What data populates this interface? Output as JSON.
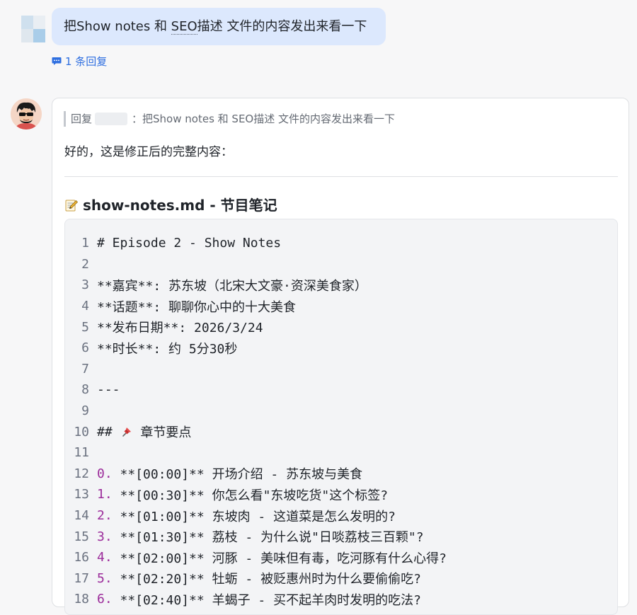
{
  "user_message": {
    "text_before": "把Show notes 和 ",
    "text_seo": "SEO",
    "text_after": "描述 文件的内容发出来看一下"
  },
  "thread": {
    "reply_count_label": "1 条回复"
  },
  "bot_message": {
    "quote_prefix": "回复",
    "quote_colon": "：",
    "quote_text": "把Show notes 和 SEO描述 文件的内容发出来看一下",
    "intro": "好的，这是修正后的完整内容：",
    "section_title": "show-notes.md - 节目笔记",
    "code_lines": [
      {
        "n": "1",
        "num": "",
        "text": "# Episode 2 - Show Notes"
      },
      {
        "n": "2",
        "num": "",
        "text": ""
      },
      {
        "n": "3",
        "num": "",
        "text": "**嘉宾**: 苏东坡（北宋大文豪·资深美食家）"
      },
      {
        "n": "4",
        "num": "",
        "text": "**话题**: 聊聊你心中的十大美食"
      },
      {
        "n": "5",
        "num": "",
        "text": "**发布日期**: 2026/3/24"
      },
      {
        "n": "6",
        "num": "",
        "text": "**时长**: 约 5分30秒"
      },
      {
        "n": "7",
        "num": "",
        "text": ""
      },
      {
        "n": "8",
        "num": "",
        "text": "---"
      },
      {
        "n": "9",
        "num": "",
        "text": ""
      },
      {
        "n": "10",
        "num": "",
        "text": "## ",
        "pin": true,
        "after": " 章节要点"
      },
      {
        "n": "11",
        "num": "",
        "text": ""
      },
      {
        "n": "12",
        "num": "0.",
        "text": " **[00:00]** 开场介绍 - 苏东坡与美食"
      },
      {
        "n": "13",
        "num": "1.",
        "text": " **[00:30]** 你怎么看\"东坡吃货\"这个标签?"
      },
      {
        "n": "14",
        "num": "2.",
        "text": " **[01:00]** 东坡肉 - 这道菜是怎么发明的?"
      },
      {
        "n": "15",
        "num": "3.",
        "text": " **[01:30]** 荔枝 - 为什么说\"日啖荔枝三百颗\"?"
      },
      {
        "n": "16",
        "num": "4.",
        "text": " **[02:00]** 河豚 - 美味但有毒，吃河豚有什么心得?"
      },
      {
        "n": "17",
        "num": "5.",
        "text": " **[02:20]** 牡蛎 - 被贬惠州时为什么要偷偷吃?"
      },
      {
        "n": "18",
        "num": "6.",
        "text": " **[02:40]** 羊蝎子 - 买不起羊肉时发明的吃法?"
      }
    ]
  },
  "colors": {
    "user_bubble": "#dce8fd",
    "link_blue": "#2f6fe0",
    "code_bg": "#f3f4f6",
    "list_number": "#9b2b9a"
  },
  "icons": {
    "reply": "chat-bubble-icon",
    "section": "memo-icon",
    "heading_marker": "pushpin-icon"
  }
}
